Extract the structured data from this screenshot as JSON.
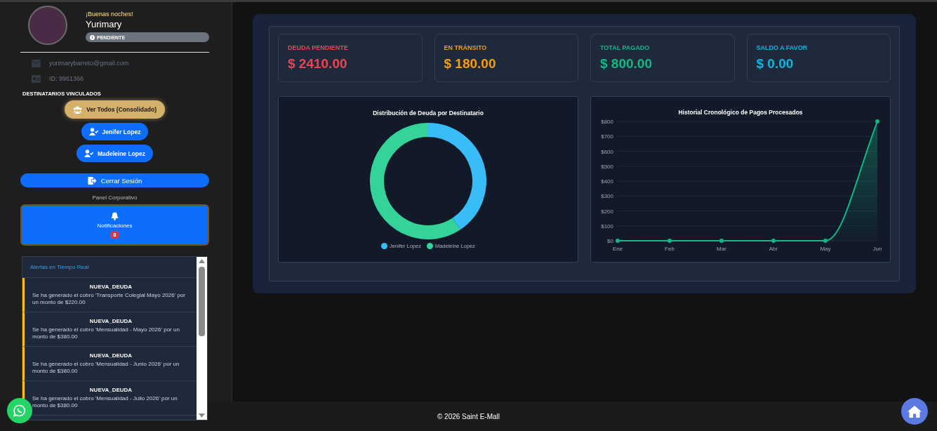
{
  "user": {
    "greeting": "¡Buenas noches!",
    "name": "Yurimary",
    "status": {
      "label": "PENDIENTE"
    }
  },
  "contact": [
    {
      "kind": "email",
      "text": "yurimarybarreto@gmail.com"
    },
    {
      "kind": "id",
      "text": "ID: 9961368"
    }
  ],
  "recipients": {
    "heading": "DESTINATARIOS VINCULADOS",
    "buttons": [
      {
        "label": "Ver Todos (Consolidado)",
        "selected": true
      },
      {
        "label": "Jenifer Lopez",
        "selected": false
      },
      {
        "label": "Madeleine Lopez",
        "selected": false
      }
    ]
  },
  "logout": "Cerrar Sesión",
  "panel_label": "Panel Corporativo",
  "notifications": {
    "label": "Notificaciones",
    "count": "8",
    "header": "Alertas en Tiempo Real",
    "items": [
      {
        "title": "NUEVA_DEUDA",
        "message": "Se ha generado el cobro 'Transporte Colegial Mayo 2026' por un monto de $220.00"
      },
      {
        "title": "NUEVA_DEUDA",
        "message": "Se ha generado el cobro 'Mensualidad - Mayo 2026' por un monto de $380.00"
      },
      {
        "title": "NUEVA_DEUDA",
        "message": "Se ha generado el cobro 'Mensualidad - Junio 2026' por un monto de $380.00"
      },
      {
        "title": "NUEVA_DEUDA",
        "message": "Se ha generado el cobro 'Mensualidad - Julio 2026' por un monto de $380.00"
      }
    ]
  },
  "stats": [
    {
      "label": "DEUDA PENDIENTE",
      "value": "$ 2410.00",
      "color": "#f0434f"
    },
    {
      "label": "EN TRÁNSITO",
      "value": "$ 180.00",
      "color": "#f59e0b"
    },
    {
      "label": "TOTAL PAGADO",
      "value": "$ 800.00",
      "color": "#10b981"
    },
    {
      "label": "SALDO A FAVOR",
      "value": "$ 0.00",
      "color": "#0fb4dc"
    }
  ],
  "donut": {
    "title": "Distribución de Deuda por Destinatario",
    "legend": [
      {
        "label": "Jenifer Lopez",
        "color": "#38bdf8"
      },
      {
        "label": "Madeleine Lopez",
        "color": "#34d399"
      }
    ]
  },
  "line_chart": {
    "chart_data": {
      "type": "line",
      "title": "Historial Cronológico de Pagos Procesados",
      "categories": [
        "Ene",
        "Feb",
        "Mar",
        "Abr",
        "May",
        "Jun"
      ],
      "series": [
        {
          "color": "#10b981",
          "marker": true,
          "values": [
            0,
            0,
            0,
            0,
            0,
            800
          ]
        }
      ],
      "grid": true,
      "ylim": [
        0,
        800
      ],
      "yticks": [
        {
          "value": 0,
          "label": "$0"
        },
        {
          "value": 100,
          "label": "$100"
        },
        {
          "value": 200,
          "label": "$200"
        },
        {
          "value": 300,
          "label": "$300"
        },
        {
          "value": 400,
          "label": "$400"
        },
        {
          "value": 500,
          "label": "$500"
        },
        {
          "value": 600,
          "label": "$600"
        },
        {
          "value": 700,
          "label": "$700"
        },
        {
          "value": 800,
          "label": "$800"
        }
      ]
    }
  },
  "footer": "© 2026 Saint E-Mall"
}
